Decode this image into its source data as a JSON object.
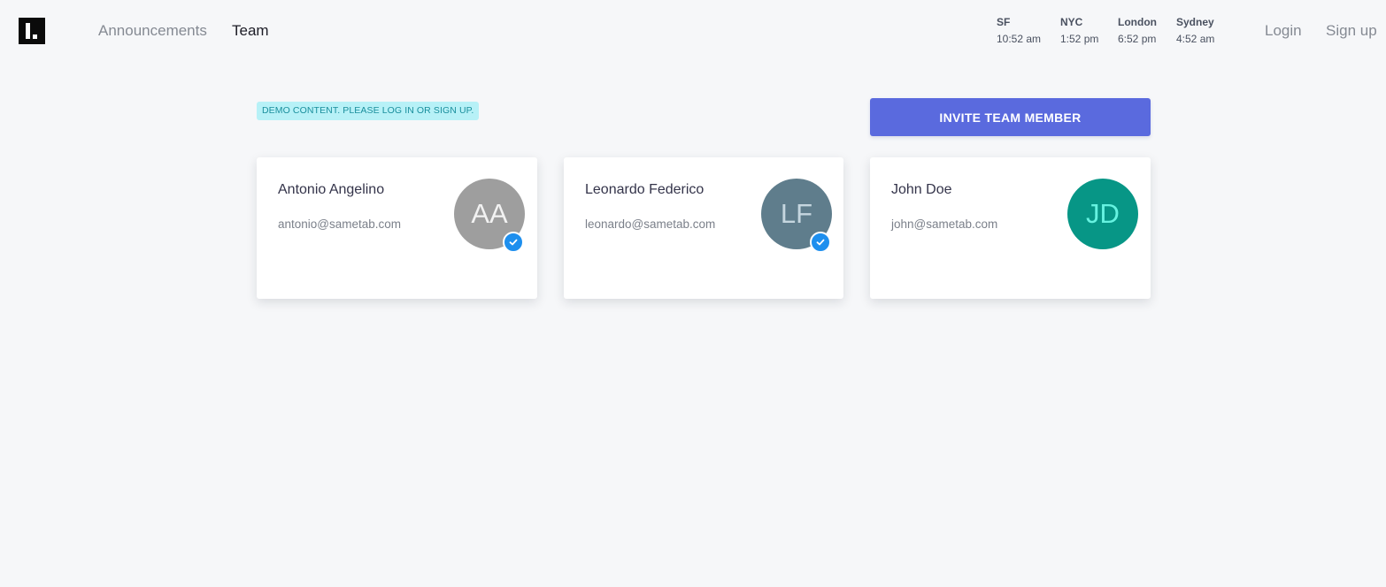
{
  "header": {
    "nav": [
      {
        "label": "Announcements"
      },
      {
        "label": "Team"
      }
    ],
    "clocks": [
      {
        "city": "SF",
        "time": "10:52 am"
      },
      {
        "city": "NYC",
        "time": "1:52 pm"
      },
      {
        "city": "London",
        "time": "6:52 pm"
      },
      {
        "city": "Sydney",
        "time": "4:52 am"
      }
    ],
    "login_label": "Login",
    "signup_label": "Sign up"
  },
  "main": {
    "demo_notice": "DEMO CONTENT. PLEASE LOG IN OR SIGN UP.",
    "invite_label": "INVITE TEAM MEMBER",
    "members": [
      {
        "name": "Antonio Angelino",
        "email": "antonio@sametab.com",
        "initials": "AA",
        "verified": true,
        "avatar_color": "#9e9e9e",
        "initials_color": "#f2f2f2"
      },
      {
        "name": "Leonardo Federico",
        "email": "leonardo@sametab.com",
        "initials": "LF",
        "verified": true,
        "avatar_color": "#5f7d8c",
        "initials_color": "#c5d6df"
      },
      {
        "name": "John Doe",
        "email": "john@sametab.com",
        "initials": "JD",
        "verified": false,
        "avatar_color": "#079686",
        "initials_color": "#66f2e0"
      }
    ]
  },
  "colors": {
    "accent": "#5a6ade",
    "verified_badge": "#1e8fee",
    "background": "#f6f7f9"
  }
}
